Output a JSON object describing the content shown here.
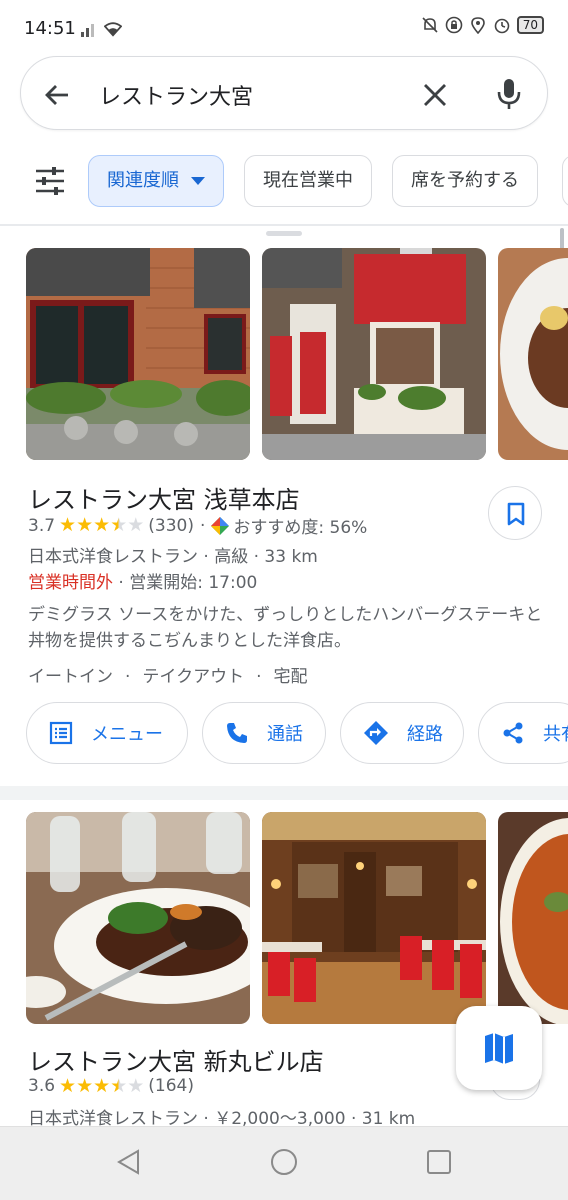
{
  "status_bar": {
    "time": "14:51",
    "battery": "70",
    "icons": [
      "signal-icon",
      "wifi-icon",
      "mute-icon",
      "vpn-icon",
      "location-icon",
      "alarm-icon",
      "battery-icon"
    ]
  },
  "search": {
    "query": "レストラン大宮",
    "icons": [
      "back-arrow-icon",
      "clear-icon",
      "mic-icon"
    ]
  },
  "chips": {
    "filter_icon": "tune-icon",
    "items": [
      {
        "label": "関連度順",
        "active": true
      },
      {
        "label": "現在営業中",
        "active": false
      },
      {
        "label": "席を予約する",
        "active": false
      }
    ]
  },
  "listings": [
    {
      "name": "レストラン大宮 浅草本店",
      "rating": "3.7",
      "stars": 3.5,
      "reviews": "(330)",
      "recommend": "おすすめ度: 56%",
      "category_line": "日本式洋食レストラン · 高級 · 33 km",
      "status": "営業時間外",
      "open_time": "· 営業開始: 17:00",
      "description": "デミグラス ソースをかけた、ずっしりとしたハンバーグステーキと丼物を提供するこぢんまりとした洋食店。",
      "services": [
        "イートイン",
        "テイクアウト",
        "宅配"
      ],
      "actions": [
        {
          "label": "メニュー",
          "icon": "menu-book-icon"
        },
        {
          "label": "通話",
          "icon": "phone-icon"
        },
        {
          "label": "経路",
          "icon": "directions-icon"
        },
        {
          "label": "共有",
          "icon": "share-icon"
        }
      ]
    },
    {
      "name": "レストラン大宮 新丸ビル店",
      "rating": "3.6",
      "stars": 3.5,
      "reviews": "(164)",
      "category_line": "日本式洋食レストラン · ￥2,000～3,000 · 31 km"
    }
  ],
  "colors": {
    "accent": "#1a73e8",
    "closed": "#d93025",
    "star": "#fbbc04"
  }
}
